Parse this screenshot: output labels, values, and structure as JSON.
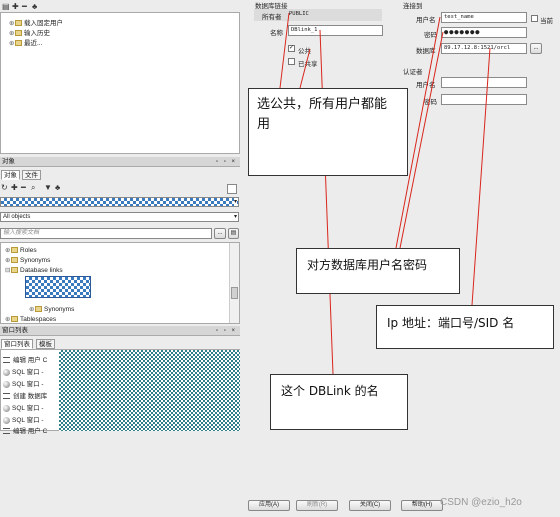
{
  "toolbar_top": {
    "icons": [
      "open-folder-icon",
      "add-icon",
      "remove-icon",
      "users-icon"
    ]
  },
  "history_tree": {
    "items": [
      {
        "label": "载入固定用户"
      },
      {
        "label": "输入历史"
      },
      {
        "label": "最近..."
      }
    ]
  },
  "objects_panel": {
    "header": "对象",
    "header_controls": "▫ ▫ ×",
    "tabs": [
      {
        "label": "对象"
      },
      {
        "label": "文件"
      }
    ],
    "filter_combo": "All objects",
    "search_placeholder": "输入搜索文档",
    "search_button": "...",
    "tree": [
      {
        "label": "Roles",
        "exp": "⊕"
      },
      {
        "label": "Synonyms",
        "exp": "⊕"
      },
      {
        "label": "Database links",
        "exp": "⊟"
      },
      {
        "label": "",
        "exp": ""
      },
      {
        "label": "Synonyms",
        "exp": "⊕"
      },
      {
        "label": "Tablespaces",
        "exp": "⊕"
      }
    ]
  },
  "window_list": {
    "header": "窗口列表",
    "header_controls": "▫ ▫ ×",
    "tabs": [
      {
        "label": "窗口列表"
      },
      {
        "label": "模板"
      }
    ],
    "rows": [
      {
        "label": "编辑 用户 C"
      },
      {
        "label": "SQL 窗口 -"
      },
      {
        "label": "SQL 窗口 -"
      },
      {
        "label": "创建 数据库"
      },
      {
        "label": "SQL 窗口 -"
      },
      {
        "label": "SQL 窗口 -"
      },
      {
        "label": "编辑 用户 C"
      }
    ]
  },
  "dblink_form": {
    "section_title": "数据库链接",
    "owner_label": "所有者",
    "owner_value": "PUBLIC",
    "name_label": "名称",
    "name_value": "DBlink_1",
    "public_label": "公共",
    "public_checked": true,
    "shared_label": "已共享",
    "shared_checked": false
  },
  "connect_to": {
    "section_title": "连接到",
    "username_label": "用户名",
    "username_value": "test_name",
    "current_label": "当前",
    "password_label": "密码",
    "password_value": "●●●●●●●",
    "database_label": "数据库",
    "database_value": "89.17.12.8:1521/orcl",
    "browse_button": "..."
  },
  "auth": {
    "section_title": "认证者",
    "username_label": "用户名",
    "password_label": "密码"
  },
  "buttons": {
    "apply": "应用(A)",
    "refresh": "刷新(R)",
    "close": "关闭(C)",
    "help": "帮助(H)"
  },
  "annotations": {
    "public_note": "选公共，所有用户都能用",
    "user_pwd_note": "对方数据库用户名密码",
    "ip_note": "Ip 地址：端口号/SID 名",
    "dblink_name_note": "这个 DBLink 的名"
  },
  "watermark": "CSDN @ezio_h2o",
  "colors": {
    "annotation_line": "#d9261c",
    "selection_blue": "#3a7bbf",
    "dialog_bg": "#ececec"
  }
}
